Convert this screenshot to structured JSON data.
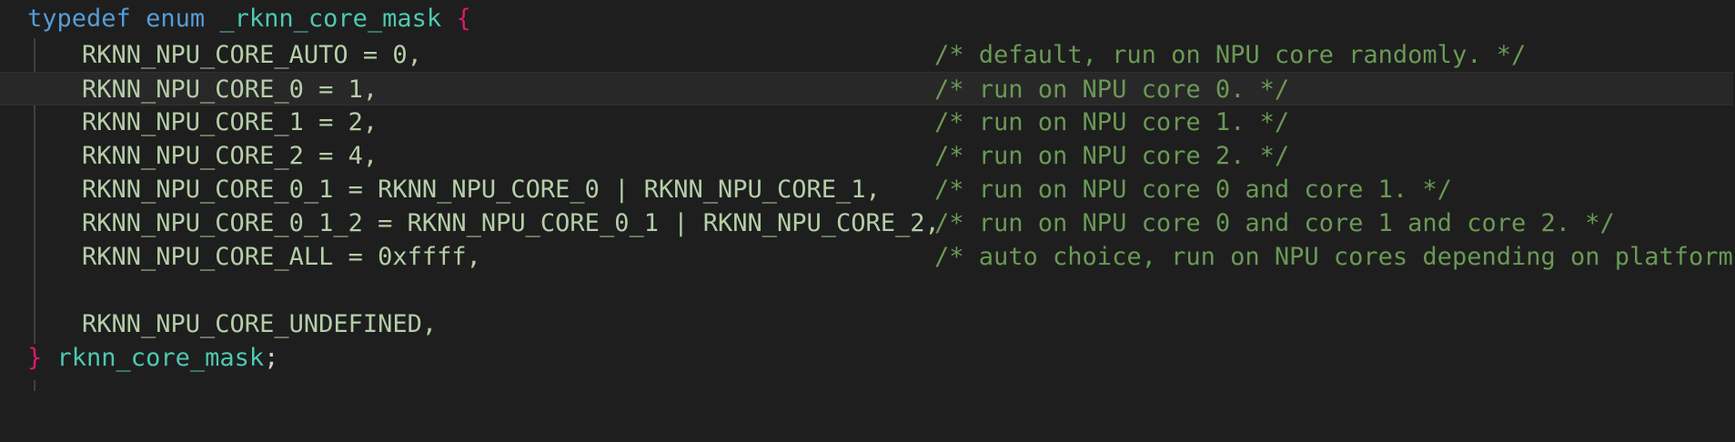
{
  "editor": {
    "header": {
      "typedef": "typedef",
      "enum": "enum",
      "name": "_rknn_core_mask",
      "open_brace": "{"
    },
    "members": [
      {
        "code": "RKNN_NPU_CORE_AUTO = 0,",
        "comment": "/* default, run on NPU core randomly. */"
      },
      {
        "code": "RKNN_NPU_CORE_0 = 1,",
        "comment": "/* run on NPU core 0. */"
      },
      {
        "code": "RKNN_NPU_CORE_1 = 2,",
        "comment": "/* run on NPU core 1. */"
      },
      {
        "code": "RKNN_NPU_CORE_2 = 4,",
        "comment": "/* run on NPU core 2. */"
      },
      {
        "code": "RKNN_NPU_CORE_0_1 = RKNN_NPU_CORE_0 | RKNN_NPU_CORE_1,",
        "comment": "/* run on NPU core 0 and core 1. */"
      },
      {
        "code": "RKNN_NPU_CORE_0_1_2 = RKNN_NPU_CORE_0_1 | RKNN_NPU_CORE_2,",
        "comment": "/* run on NPU core 0 and core 1 and core 2. */"
      },
      {
        "code": "RKNN_NPU_CORE_ALL = 0xffff,",
        "comment": "/* auto choice, run on NPU cores depending on platform */"
      },
      {
        "code": "RKNN_NPU_CORE_UNDEFINED,",
        "comment": ""
      }
    ],
    "footer": {
      "close_brace": "}",
      "alias": "rknn_core_mask",
      "semicolon": ";"
    },
    "colors": {
      "background": "#1e1e1e",
      "keyword": "#569cd6",
      "type": "#4ec9b0",
      "brace": "#da1a6d",
      "enum_member": "#b5cea8",
      "comment": "#6a9955",
      "current_line": "#282828"
    }
  }
}
